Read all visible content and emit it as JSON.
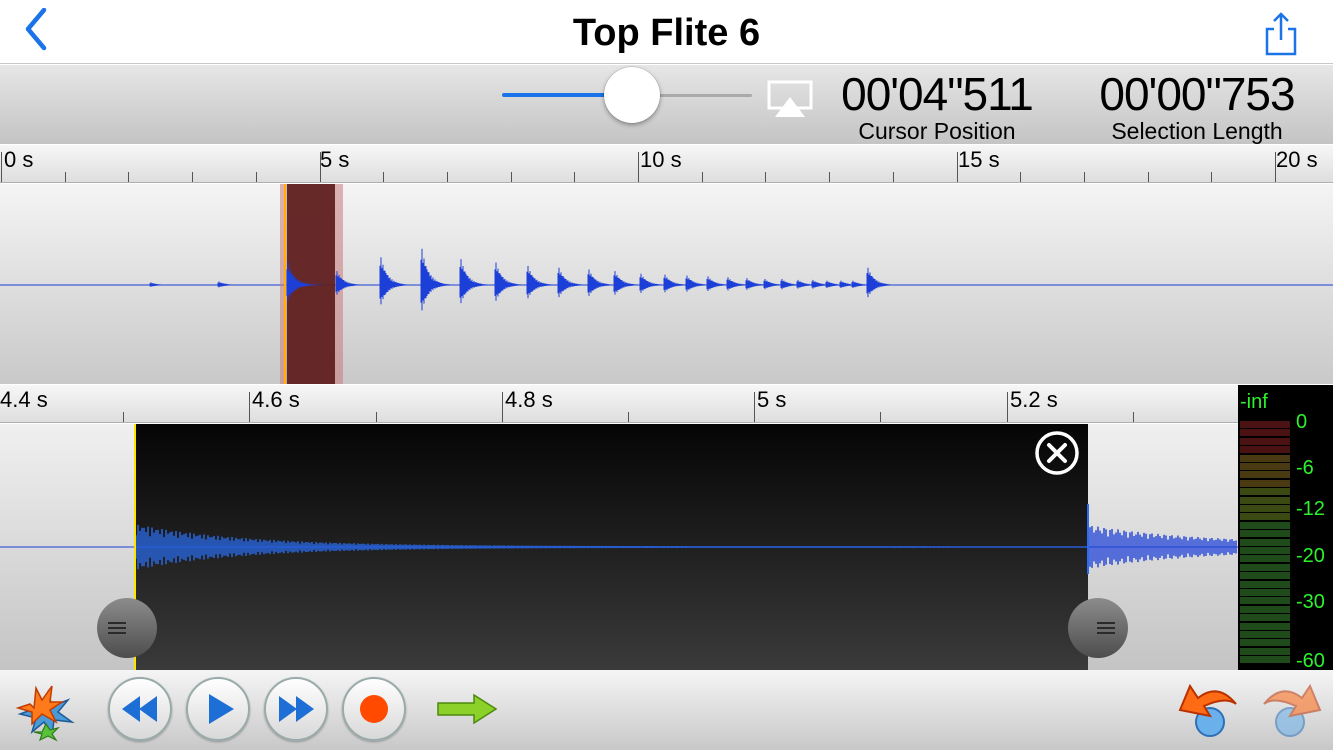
{
  "nav": {
    "title": "Top Flite 6"
  },
  "info": {
    "volume": 0.52,
    "cursor_position": {
      "value": "00'04\"511",
      "label": "Cursor Position"
    },
    "selection_length": {
      "value": "00'00\"753",
      "label": "Selection Length"
    }
  },
  "ruler_top": {
    "labels": [
      "0 s",
      "5 s",
      "10 s",
      "15 s",
      "20 s"
    ]
  },
  "ruler_bottom": {
    "labels": [
      "4.4 s",
      "4.6 s",
      "4.8 s",
      "5 s",
      "5.2 s"
    ]
  },
  "meter": {
    "top_label": "-inf",
    "labels": [
      "0",
      "-6",
      "-12",
      "-20",
      "-30",
      "-60"
    ]
  },
  "icons": {
    "back": "chevron-left-icon",
    "share": "share-icon",
    "airplay": "airplay-icon",
    "close": "close-circle-icon",
    "effects": "effects-burst-icon",
    "rewind": "rewind-icon",
    "play": "play-icon",
    "fast_forward": "fast-forward-icon",
    "record": "record-icon",
    "next": "green-arrow-right-icon",
    "undo": "undo-icon",
    "redo": "redo-icon"
  },
  "colors": {
    "accent": "#1a73e8",
    "waveform": "#1c3fd8",
    "selection": "#5a1a1a",
    "meter_text": "#2cf12c",
    "record": "#ff4a00"
  }
}
